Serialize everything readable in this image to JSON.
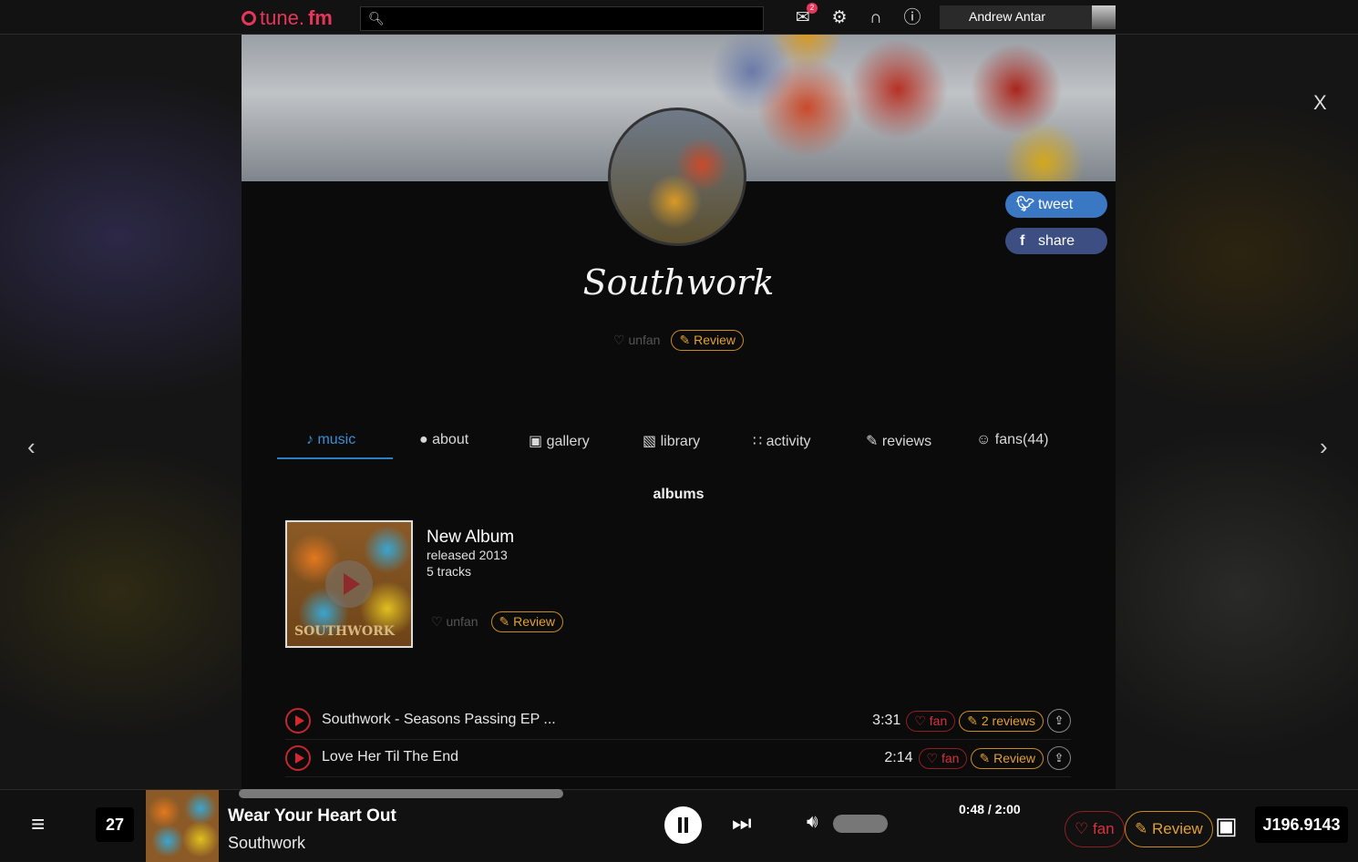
{
  "topbar": {
    "logo_prefix": "tune.",
    "logo_suffix": "fm",
    "search_placeholder": "",
    "mail_badge": "2",
    "user_name": "Andrew Antar"
  },
  "artist": {
    "name": "Southwork",
    "unfan_label": "unfan",
    "review_label": "Review",
    "tweet_label": "tweet",
    "share_label": "share"
  },
  "tabs": [
    {
      "label": "music",
      "icon": "music-note-icon"
    },
    {
      "label": "about",
      "icon": "person-icon"
    },
    {
      "label": "gallery",
      "icon": "gallery-icon"
    },
    {
      "label": "library",
      "icon": "library-icon"
    },
    {
      "label": "activity",
      "icon": "rss-icon"
    },
    {
      "label": "reviews",
      "icon": "review-icon"
    },
    {
      "label": "fans(44)",
      "icon": "people-icon"
    }
  ],
  "albums": {
    "section_title": "albums",
    "items": [
      {
        "title": "New Album",
        "released": "released 2013",
        "tracks": "5 tracks",
        "unfan_label": "unfan",
        "review_label": "Review",
        "cover_text": "SOUTHWORK"
      }
    ]
  },
  "tracks": [
    {
      "title": "Southwork - Seasons Passing EP ...",
      "duration": "3:31",
      "fan_label": "fan",
      "review_label": "2 reviews"
    },
    {
      "title": "Love Her Til The End",
      "duration": "2:14",
      "fan_label": "fan",
      "review_label": "Review"
    }
  ],
  "player": {
    "queue_count": "27",
    "song": "Wear Your Heart Out",
    "artist": "Southwork",
    "time": "0:48 / 2:00",
    "progress_fraction": 0.4,
    "fan_label": "fan",
    "review_label": "Review",
    "balance": "J196.9143"
  },
  "close_label": "X",
  "colors": {
    "accent": "#e8365a",
    "tab_active": "#3a8fd6",
    "review_orange": "#e2a031",
    "fan_red": "#d8323b",
    "tweet_blue": "#3b78c4",
    "facebook_blue": "#3c4e82"
  }
}
